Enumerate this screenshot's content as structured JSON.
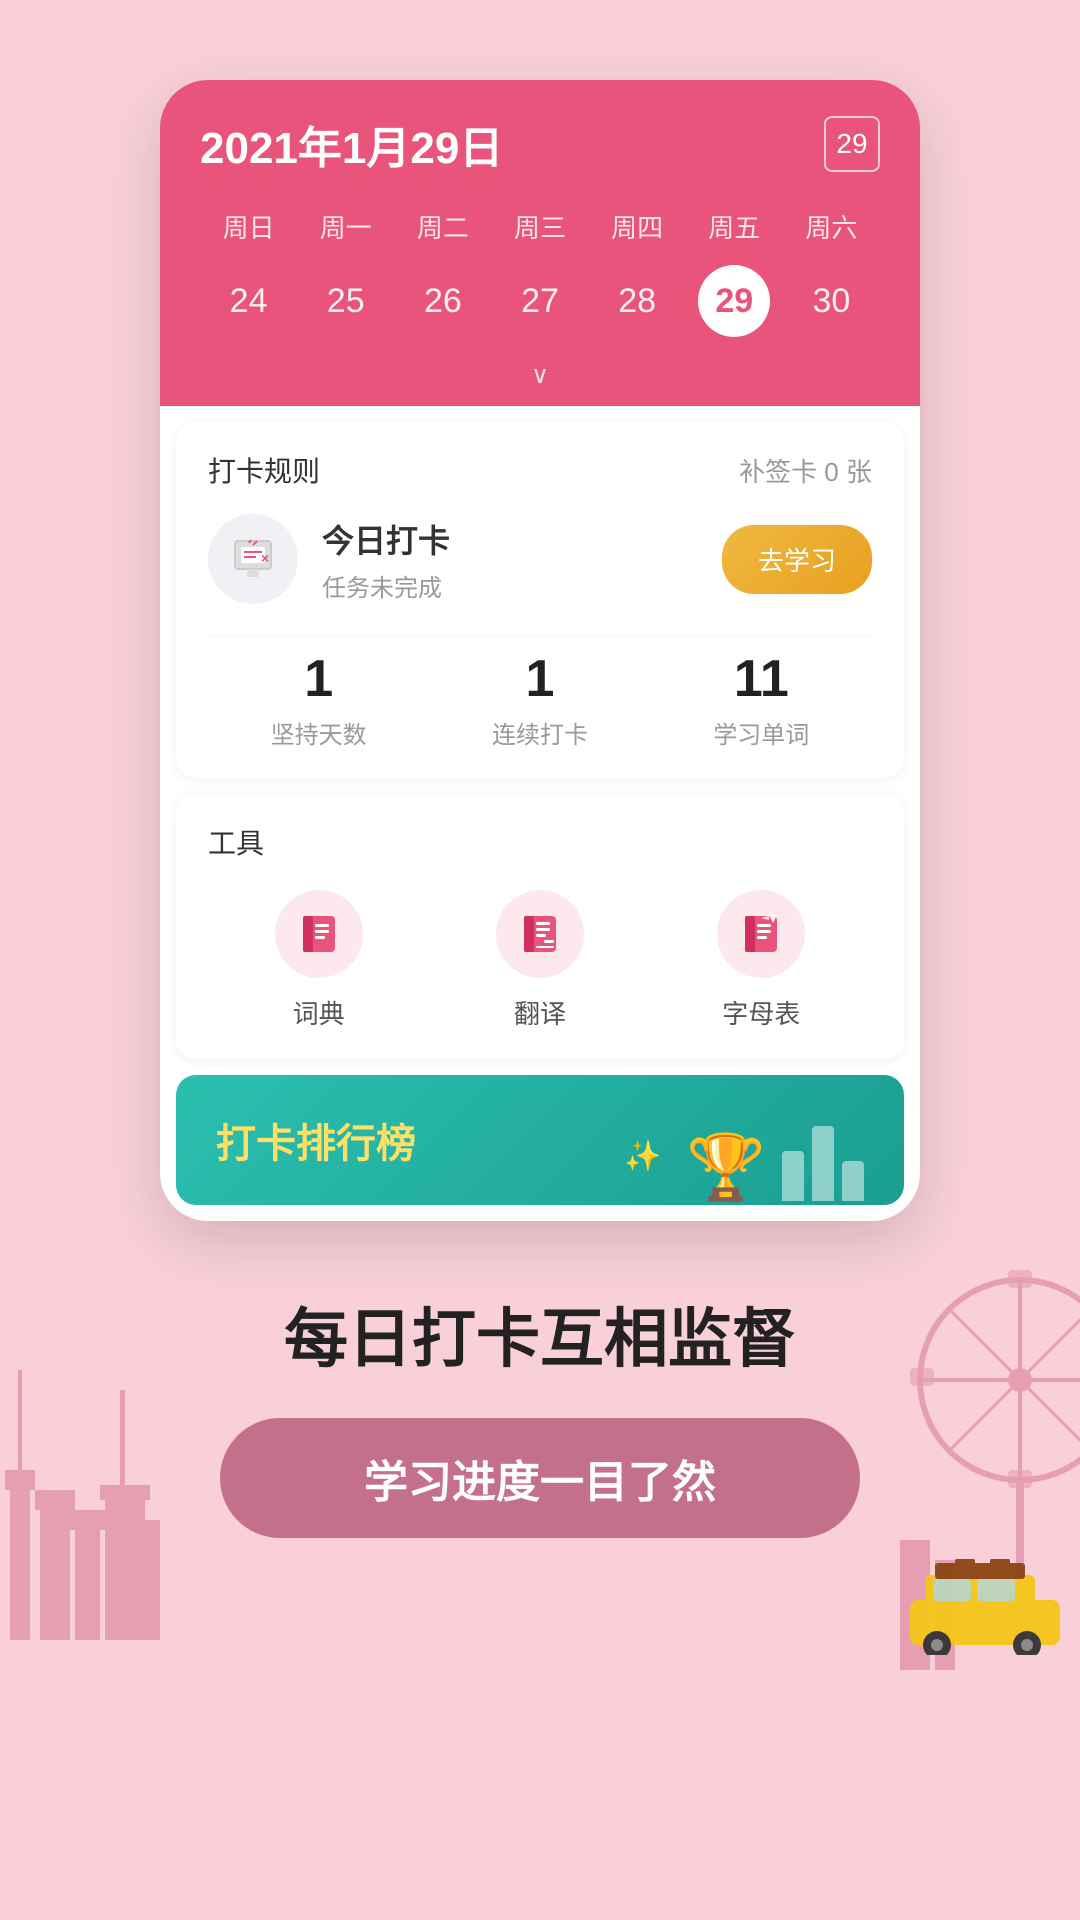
{
  "background_color": "#f9d0d8",
  "accent_color": "#e8547a",
  "teal_color": "#2bbfb0",
  "calendar": {
    "date_title": "2021年1月29日",
    "weekdays": [
      "周日",
      "周一",
      "周二",
      "周三",
      "周四",
      "周五",
      "周六"
    ],
    "days": [
      "24",
      "25",
      "26",
      "27",
      "28",
      "29",
      "30"
    ],
    "active_day": "29",
    "icon_label": "29"
  },
  "punch_card": {
    "section_title": "打卡规则",
    "supplement_label": "补签卡 0 张",
    "today_punch_name": "今日打卡",
    "today_punch_status": "任务未完成",
    "study_button_label": "去学习",
    "stats": [
      {
        "number": "1",
        "label": "坚持天数"
      },
      {
        "number": "1",
        "label": "连续打卡"
      },
      {
        "number": "11",
        "label": "学习单词"
      }
    ]
  },
  "tools": {
    "section_title": "工具",
    "items": [
      {
        "icon": "📖",
        "label": "词典"
      },
      {
        "icon": "📝",
        "label": "翻译"
      },
      {
        "icon": "📄",
        "label": "字母表"
      }
    ]
  },
  "ranking": {
    "text_prefix": "打卡",
    "text_highlight": "排行榜",
    "trophy_icon": "🏆"
  },
  "bottom": {
    "tagline": "每日打卡互相监督",
    "cta_label": "学习进度一目了然"
  }
}
